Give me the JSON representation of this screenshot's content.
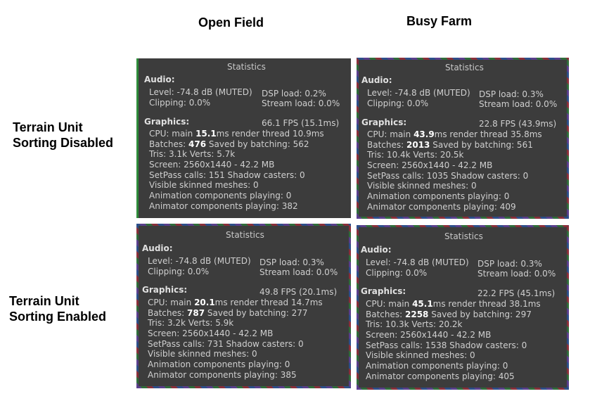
{
  "columns": [
    "Open Field",
    "Busy Farm"
  ],
  "rows": [
    [
      "Terrain Unit",
      "Sorting Disabled"
    ],
    [
      "Terrain Unit",
      "Sorting Enabled"
    ]
  ],
  "panels": [
    {
      "id": "open-disabled",
      "title": "Statistics",
      "audio_header": "Audio:",
      "level": "Level: -74.8 dB (MUTED)",
      "dsp": "DSP load: 0.2%",
      "clipping": "Clipping: 0.0%",
      "stream": "Stream load: 0.0%",
      "graphics_header": "Graphics:",
      "fps": "66.1 FPS (15.1ms)",
      "cpu_prefix": "CPU: main ",
      "cpu_main": "15.1",
      "cpu_suffix": "ms  render thread 10.9ms",
      "batches_prefix": "Batches: ",
      "batches": "476",
      "batches_suffix": "    Saved by batching: 562",
      "tris": "Tris: 3.1k     Verts: 5.7k",
      "screen": "Screen: 2560x1440 - 42.2 MB",
      "setpass": "SetPass calls: 151      Shadow casters: 0",
      "skinned": "Visible skinned meshes: 0",
      "anim": "Animation components playing: 0",
      "animator": "Animator components playing: 382"
    },
    {
      "id": "busy-disabled",
      "title": "Statistics",
      "audio_header": "Audio:",
      "level": "Level: -74.8 dB (MUTED)",
      "dsp": "DSP load: 0.3%",
      "clipping": "Clipping: 0.0%",
      "stream": "Stream load: 0.0%",
      "graphics_header": "Graphics:",
      "fps": "22.8 FPS (43.9ms)",
      "cpu_prefix": "CPU: main ",
      "cpu_main": "43.9",
      "cpu_suffix": "ms  render thread 35.8ms",
      "batches_prefix": "Batches: ",
      "batches": "2013",
      "batches_suffix": "  Saved by batching: 561",
      "tris": "Tris: 10.4k     Verts: 20.5k",
      "screen": "Screen: 2560x1440 - 42.2 MB",
      "setpass": "SetPass calls: 1035     Shadow casters: 0",
      "skinned": "Visible skinned meshes: 0",
      "anim": "Animation components playing: 0",
      "animator": "Animator components playing: 409"
    },
    {
      "id": "open-enabled",
      "title": "Statistics",
      "audio_header": "Audio:",
      "level": "Level: -74.8 dB (MUTED)",
      "dsp": "DSP load: 0.3%",
      "clipping": "Clipping: 0.0%",
      "stream": "Stream load: 0.0%",
      "graphics_header": "Graphics:",
      "fps": "49.8 FPS (20.1ms)",
      "cpu_prefix": "CPU: main ",
      "cpu_main": "20.1",
      "cpu_suffix": "ms  render thread 14.7ms",
      "batches_prefix": "Batches: ",
      "batches": "787",
      "batches_suffix": "    Saved by batching: 277",
      "tris": "Tris: 3.2k   Verts: 5.9k",
      "screen": "Screen: 2560x1440 - 42.2 MB",
      "setpass": "SetPass calls: 731      Shadow casters: 0",
      "skinned": "Visible skinned meshes: 0",
      "anim": "Animation components playing: 0",
      "animator": "Animator components playing: 385"
    },
    {
      "id": "busy-enabled",
      "title": "Statistics",
      "audio_header": "Audio:",
      "level": "Level: -74.8 dB (MUTED)",
      "dsp": "DSP load: 0.3%",
      "clipping": "Clipping: 0.0%",
      "stream": "Stream load: 0.0%",
      "graphics_header": "Graphics:",
      "fps": "22.2 FPS (45.1ms)",
      "cpu_prefix": "CPU: main ",
      "cpu_main": "45.1",
      "cpu_suffix": "ms  render thread 38.1ms",
      "batches_prefix": "Batches: ",
      "batches": "2258",
      "batches_suffix": "  Saved by batching: 297",
      "tris": "Tris: 10.3k     Verts: 20.2k",
      "screen": "Screen: 2560x1440 - 42.2 MB",
      "setpass": "SetPass calls: 1538     Shadow casters: 0",
      "skinned": "Visible skinned meshes: 0",
      "anim": "Animation components playing: 0",
      "animator": "Animator components playing: 405"
    }
  ]
}
